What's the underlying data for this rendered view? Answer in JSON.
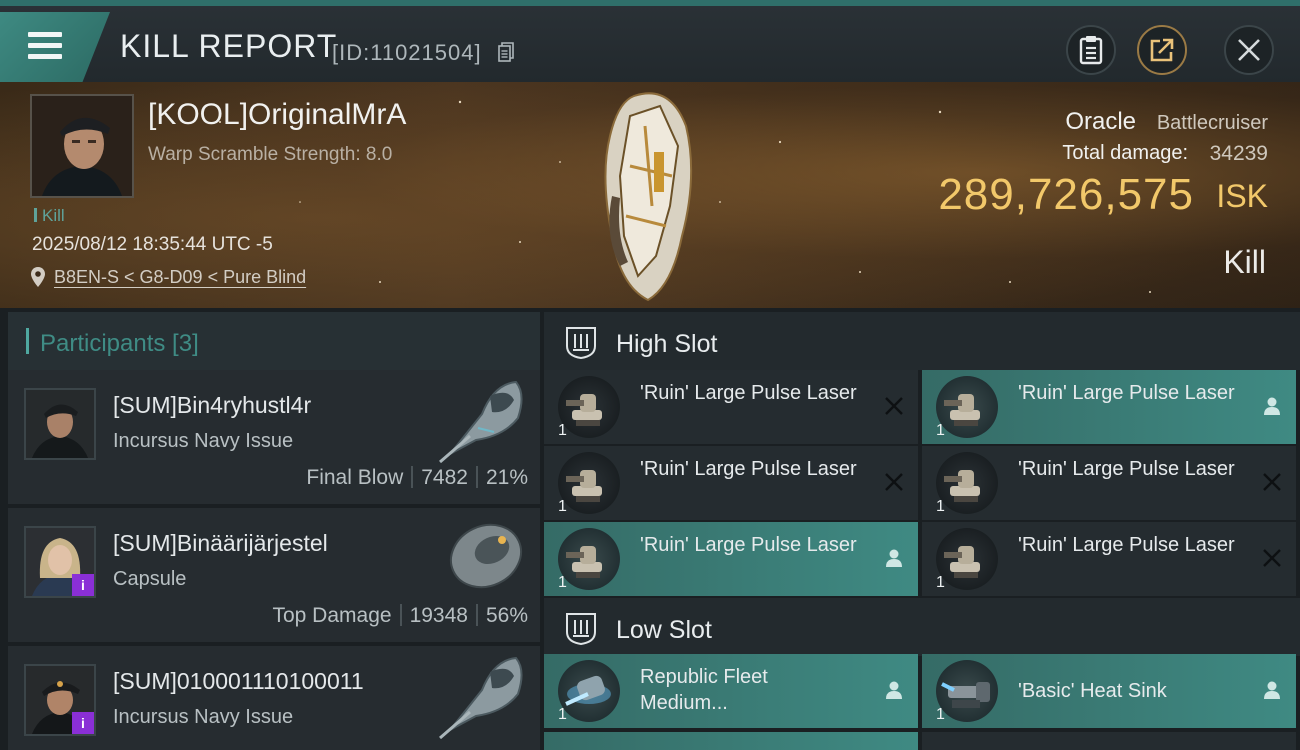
{
  "header": {
    "title": "KILL REPORT",
    "report_id": "[ID:11021504]"
  },
  "victim": {
    "name": "[KOOL]OriginalMrA",
    "warp_scramble": "Warp Scramble Strength: 8.0",
    "tag": "Kill",
    "timestamp": "2025/08/12 18:35:44 UTC -5",
    "location": "B8EN-S < G8-D09 < Pure Blind",
    "ship_name": "Oracle",
    "ship_class": "Battlecruiser",
    "total_damage_label": "Total damage:",
    "total_damage_value": "34239",
    "isk_value": "289,726,575",
    "isk_unit": "ISK",
    "result": "Kill"
  },
  "participants": {
    "title": "Participants [3]",
    "items": [
      {
        "name": "[SUM]Bin4ryhustl4r",
        "ship": "Incursus Navy Issue",
        "label": "Final Blow",
        "damage": "7482",
        "percent": "21%"
      },
      {
        "name": "[SUM]Binäärijärjestel",
        "ship": "Capsule",
        "label": "Top Damage",
        "damage": "19348",
        "percent": "56%"
      },
      {
        "name": "[SUM]010001110100011",
        "ship": "Incursus Navy Issue"
      }
    ]
  },
  "high_slot": {
    "title": "High Slot",
    "modules": [
      {
        "name": "'Ruin' Large Pulse Laser",
        "qty": "1",
        "status": "destroyed"
      },
      {
        "name": "'Ruin' Large Pulse Laser",
        "qty": "1",
        "status": "dropped"
      },
      {
        "name": "'Ruin' Large Pulse Laser",
        "qty": "1",
        "status": "destroyed"
      },
      {
        "name": "'Ruin' Large Pulse Laser",
        "qty": "1",
        "status": "destroyed"
      },
      {
        "name": "'Ruin' Large Pulse Laser",
        "qty": "1",
        "status": "dropped"
      },
      {
        "name": "'Ruin' Large Pulse Laser",
        "qty": "1",
        "status": "destroyed"
      }
    ]
  },
  "low_slot": {
    "title": "Low Slot",
    "modules": [
      {
        "name": "Republic Fleet Medium...",
        "qty": "1",
        "status": "dropped"
      },
      {
        "name": "'Basic' Heat Sink",
        "qty": "1",
        "status": "dropped"
      }
    ]
  },
  "colors": {
    "accent_teal": "#3f8a83",
    "isk_gold": "#f2c86a",
    "info_badge": "#8a2fd6"
  }
}
